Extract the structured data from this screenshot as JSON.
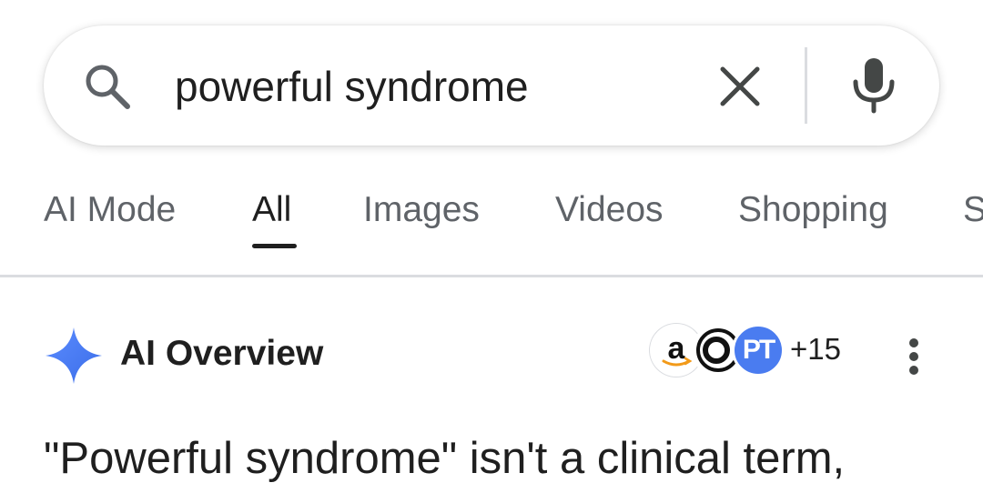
{
  "search": {
    "query": "powerful syndrome",
    "icons": {
      "search": "search-icon",
      "clear": "close-icon",
      "voice": "mic-icon"
    }
  },
  "tabs": [
    {
      "label": "AI Mode",
      "active": false
    },
    {
      "label": "All",
      "active": true
    },
    {
      "label": "Images",
      "active": false
    },
    {
      "label": "Videos",
      "active": false
    },
    {
      "label": "Shopping",
      "active": false
    },
    {
      "label": "S",
      "active": false
    }
  ],
  "ai_overview": {
    "title": "AI Overview",
    "icon": "sparkle-icon",
    "sources": {
      "avatars": [
        {
          "name": "amazon",
          "text": "a"
        },
        {
          "name": "ring-logo",
          "text": ""
        },
        {
          "name": "pt-logo",
          "text": "PT"
        }
      ],
      "more_count": "+15"
    },
    "menu_icon": "more-vert-icon",
    "text": "\"Powerful syndrome\" isn't a clinical term,"
  },
  "colors": {
    "text_primary": "#1f1f1f",
    "text_secondary": "#5f6368",
    "divider": "#dadce0",
    "accent_blue": "#4a7cf0",
    "amazon_orange": "#f29a19"
  }
}
